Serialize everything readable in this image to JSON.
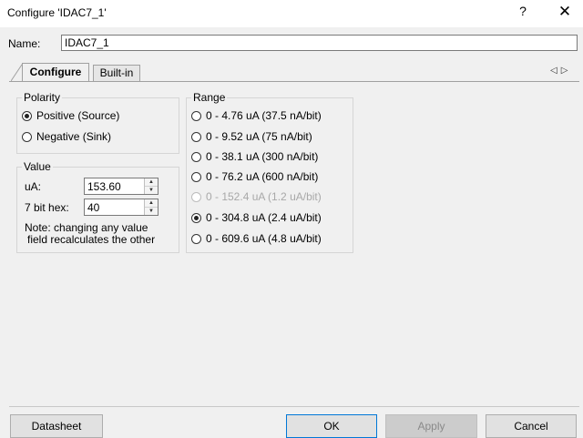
{
  "window": {
    "title": "Configure 'IDAC7_1'",
    "help_label": "?",
    "close_label": "✕"
  },
  "name_field": {
    "label": "Name:",
    "value": "IDAC7_1"
  },
  "tabs": [
    {
      "label": "Configure",
      "active": true
    },
    {
      "label": "Built-in",
      "active": false
    }
  ],
  "tab_nav_icons": [
    "arrow-left-icon",
    "arrow-right-icon"
  ],
  "polarity": {
    "legend": "Polarity",
    "options": [
      {
        "label": "Positive (Source)",
        "selected": true
      },
      {
        "label": "Negative (Sink)",
        "selected": false
      }
    ]
  },
  "value": {
    "legend": "Value",
    "ua_label": "uA:",
    "ua_value": "153.60",
    "hex_label": "7 bit hex:",
    "hex_value": "40",
    "note_line1": "Note: changing any value",
    "note_line2": "field recalculates the other"
  },
  "range": {
    "legend": "Range",
    "options": [
      {
        "label": "0 - 4.76 uA (37.5 nA/bit)",
        "selected": false,
        "enabled": true
      },
      {
        "label": "0 - 9.52 uA (75 nA/bit)",
        "selected": false,
        "enabled": true
      },
      {
        "label": "0 - 38.1 uA (300 nA/bit)",
        "selected": false,
        "enabled": true
      },
      {
        "label": "0 - 76.2 uA (600 nA/bit)",
        "selected": false,
        "enabled": true
      },
      {
        "label": "0 - 152.4 uA (1.2 uA/bit)",
        "selected": false,
        "enabled": false
      },
      {
        "label": "0 - 304.8 uA (2.4 uA/bit)",
        "selected": true,
        "enabled": true
      },
      {
        "label": "0 - 609.6 uA (4.8 uA/bit)",
        "selected": false,
        "enabled": true
      }
    ]
  },
  "buttons": {
    "datasheet": "Datasheet",
    "ok": "OK",
    "apply": "Apply",
    "cancel": "Cancel"
  }
}
